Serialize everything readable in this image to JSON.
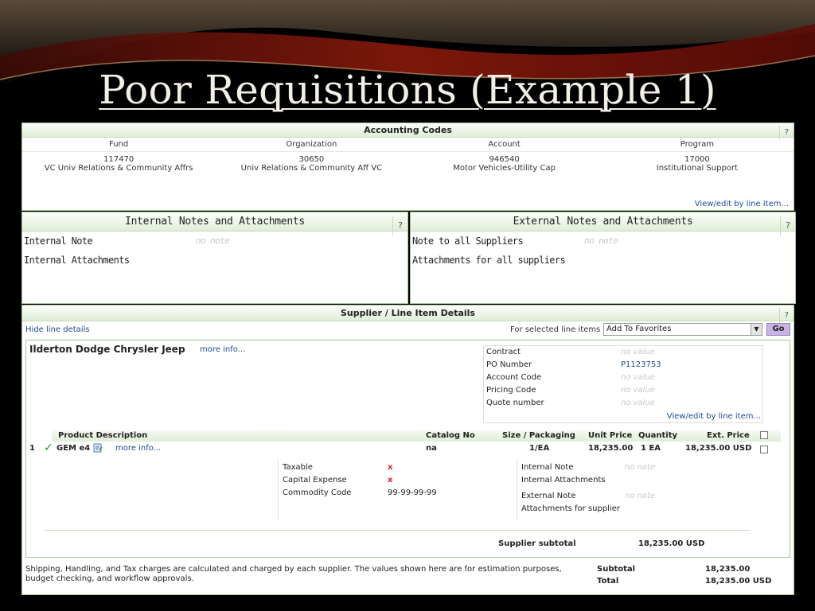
{
  "slide": {
    "title": "Poor Requisitions (Example 1)"
  },
  "accounting": {
    "title": "Accounting Codes",
    "help": "?",
    "columns": [
      {
        "header": "Fund",
        "value": "117470",
        "desc": "VC Univ Relations & Community Affrs"
      },
      {
        "header": "Organization",
        "value": "30650",
        "desc": "Univ Relations & Community Aff VC"
      },
      {
        "header": "Account",
        "value": "946540",
        "desc": "Motor Vehicles-Utility Cap"
      },
      {
        "header": "Program",
        "value": "17000",
        "desc": "Institutional Support"
      }
    ],
    "edit_link": "View/edit by line item..."
  },
  "internal_notes": {
    "title": "Internal Notes and Attachments",
    "help": "?",
    "note_label": "Internal Note",
    "note_value": "no note",
    "attachments_label": "Internal Attachments"
  },
  "external_notes": {
    "title": "External Notes and Attachments",
    "help": "?",
    "note_label": "Note to all Suppliers",
    "note_value": "no note",
    "attachments_label": "Attachments for all suppliers"
  },
  "supplier_section": {
    "title": "Supplier / Line Item Details",
    "help": "?",
    "hide_link": "Hide line details",
    "selected_label": "For selected line items",
    "action_value": "Add To Favorites",
    "go_label": "Go",
    "supplier_name": "Ilderton Dodge Chrysler Jeep",
    "more_info": "more info...",
    "po_fields": [
      {
        "label": "Contract",
        "value": "no value",
        "kind": "muted"
      },
      {
        "label": "PO Number",
        "value": "P1123753",
        "kind": "link"
      },
      {
        "label": "Account Code",
        "value": "no value",
        "kind": "muted"
      },
      {
        "label": "Pricing Code",
        "value": "no value",
        "kind": "muted"
      },
      {
        "label": "Quote number",
        "value": "no value",
        "kind": "muted"
      }
    ],
    "po_edit_link": "View/edit by line item...",
    "columns": {
      "product": "Product Description",
      "catalog": "Catalog No",
      "size": "Size / Packaging",
      "unit_price": "Unit Price",
      "quantity": "Quantity",
      "ext_price": "Ext. Price"
    },
    "line": {
      "number": "1",
      "check": "✓",
      "product": "GEM e4",
      "more_info": "more info...",
      "catalog": "na",
      "size": "1/EA",
      "unit_price": "18,235.00",
      "quantity": "1 EA",
      "ext_price": "18,235.00 USD"
    },
    "details": {
      "taxable_label": "Taxable",
      "taxable_value": "x",
      "capex_label": "Capital Expense",
      "capex_value": "x",
      "commodity_label": "Commodity Code",
      "commodity_value": "99-99-99-99",
      "internal_note_label": "Internal Note",
      "internal_note_value": "no note",
      "internal_attach_label": "Internal Attachments",
      "external_note_label": "External Note",
      "external_note_value": "no note",
      "supplier_attach_label": "Attachments for supplier"
    },
    "supplier_subtotal_label": "Supplier subtotal",
    "supplier_subtotal_value": "18,235.00 USD",
    "footer_note": "Shipping, Handling, and Tax charges are calculated and charged by each supplier. The values shown here are for estimation purposes, budget checking, and workflow approvals.",
    "subtotal_label": "Subtotal",
    "subtotal_value": "18,235.00",
    "total_label": "Total",
    "total_value": "18,235.00 USD"
  },
  "colors": {
    "panel_border": "#a8c39a",
    "header_gradient_bottom": "#dfeed6",
    "link": "#1f4b8f",
    "go_button": "#c9b3e2",
    "x_mark": "#dd2222",
    "check_mark": "#2e8b2e"
  }
}
